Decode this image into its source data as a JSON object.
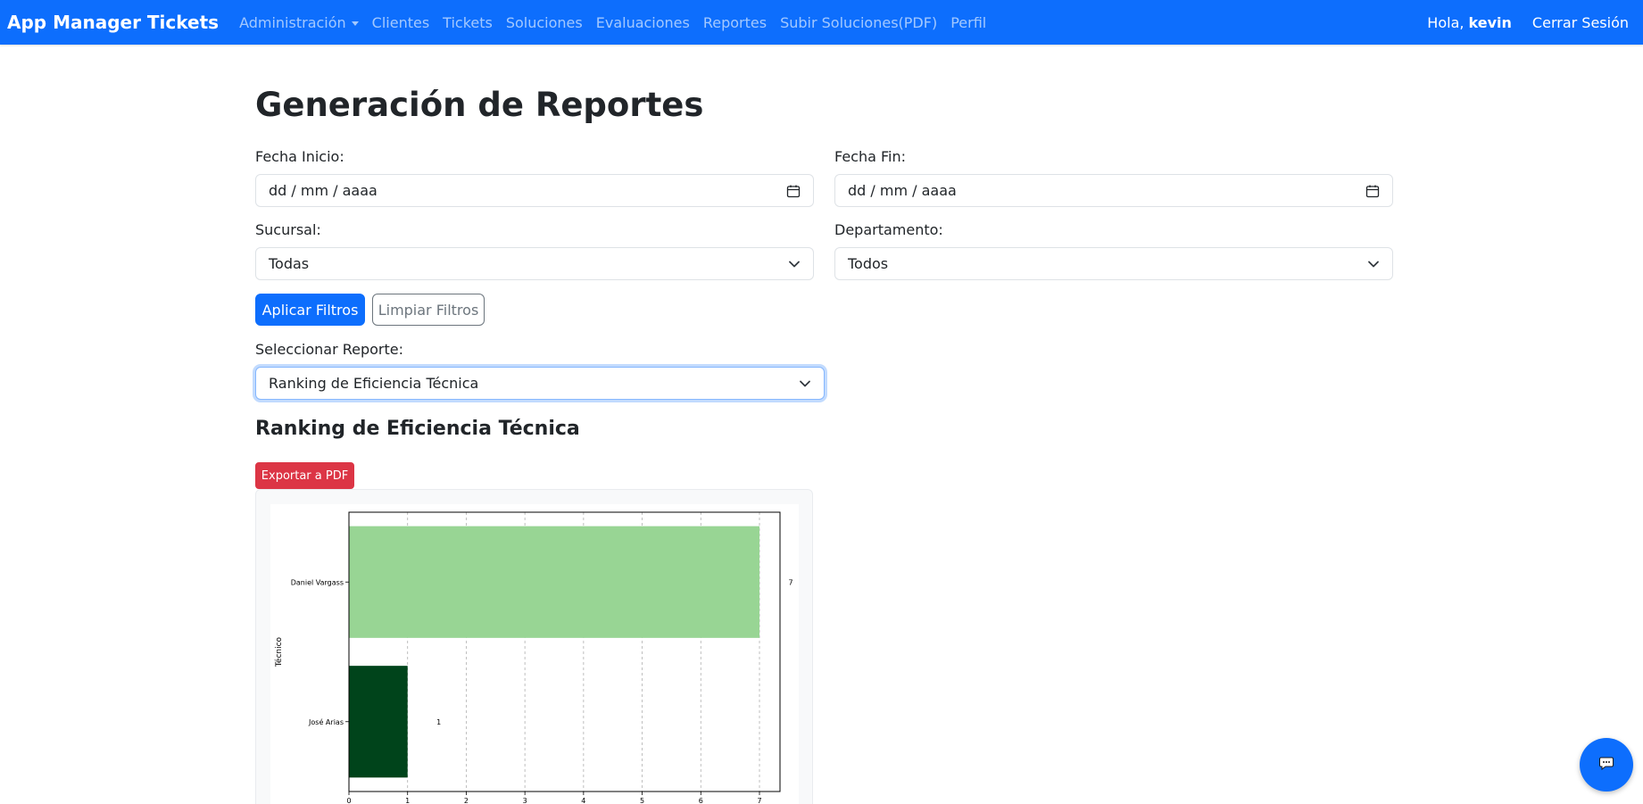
{
  "navbar": {
    "brand": "App Manager Tickets",
    "links": [
      {
        "label": "Administración",
        "dropdown": true
      },
      {
        "label": "Clientes"
      },
      {
        "label": "Tickets"
      },
      {
        "label": "Soluciones"
      },
      {
        "label": "Evaluaciones"
      },
      {
        "label": "Reportes"
      },
      {
        "label": "Subir Soluciones(PDF)"
      },
      {
        "label": "Perfil"
      }
    ],
    "greeting_prefix": "Hola,",
    "username": "kevin",
    "logout_label": "Cerrar Sesión",
    "accent": "#0d6efd"
  },
  "page": {
    "title": "Generación de Reportes"
  },
  "filters": {
    "start_date": {
      "label": "Fecha Inicio:",
      "placeholder": "dd / mm / aaaa",
      "icon": "calendar-icon"
    },
    "end_date": {
      "label": "Fecha Fin:",
      "placeholder": "dd / mm / aaaa",
      "icon": "calendar-icon"
    },
    "branch": {
      "label": "Sucursal:",
      "value": "Todas"
    },
    "department": {
      "label": "Departamento:",
      "value": "Todos"
    },
    "apply_label": "Aplicar Filtros",
    "clear_label": "Limpiar Filtros"
  },
  "report_select": {
    "label": "Seleccionar Reporte:",
    "value": "Ranking de Eficiencia Técnica"
  },
  "report": {
    "title": "Ranking de Eficiencia Técnica",
    "export_label": "Exportar a PDF",
    "export_color": "#dc3545"
  },
  "chart_data": {
    "type": "bar",
    "orientation": "horizontal",
    "categories": [
      "Daniel Vargass",
      "José Arias"
    ],
    "values": [
      7,
      1
    ],
    "value_labels": [
      "7",
      "1"
    ],
    "bar_colors": [
      "#98d594",
      "#00441b"
    ],
    "xticks": [
      0,
      1,
      2,
      3,
      4,
      5,
      6,
      7
    ],
    "xlim": [
      0,
      7.35
    ],
    "ylabel": "Técnico",
    "xlabel": "",
    "grid": "x-dashed"
  },
  "chat": {
    "icon": "chat-bubble-icon"
  }
}
